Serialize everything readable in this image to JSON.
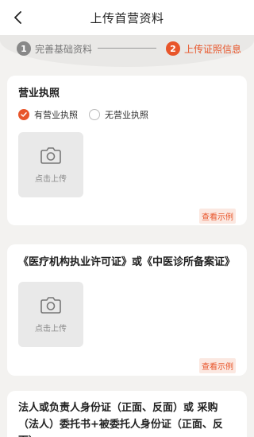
{
  "nav": {
    "title": "上传首营资料"
  },
  "steps": [
    {
      "num": "1",
      "label": "完善基础资料"
    },
    {
      "num": "2",
      "label": "上传证照信息"
    }
  ],
  "business_license": {
    "title": "营业执照",
    "options": [
      "有营业执照",
      "无营业执照"
    ],
    "selected": "有营业执照",
    "upload_label": "点击上传",
    "example_label": "查看示例"
  },
  "medical_license": {
    "title": "《医疗机构执业许可证》或《中医诊所备案证》",
    "upload_label": "点击上传",
    "example_label": "查看示例"
  },
  "id_card": {
    "title": "法人或负责人身份证（正面、反面）或 采购（法人）委托书+被委托人身份证（正面、反面）"
  },
  "colors": {
    "accent": "#e8552a"
  }
}
